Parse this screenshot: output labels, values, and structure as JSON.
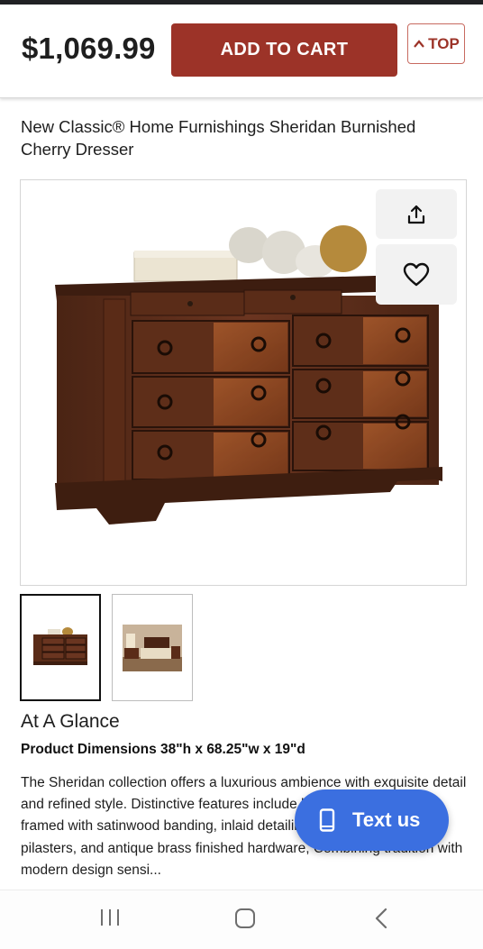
{
  "header": {
    "price": "$1,069.99",
    "add_to_cart_label": "ADD TO CART",
    "top_label": "TOP"
  },
  "product": {
    "title": "New Classic® Home Furnishings Sheridan Burnished Cherry Dresser",
    "main_image_icon": "dresser-image",
    "actions": {
      "share_icon": "share-icon",
      "favorite_icon": "heart-icon"
    },
    "thumbnails": [
      {
        "icon": "dresser-thumbnail",
        "selected": true
      },
      {
        "icon": "bedroom-thumbnail",
        "selected": false
      }
    ]
  },
  "details": {
    "heading": "At A Glance",
    "dimensions": "Product Dimensions 38\"h x 68.25\"w x 19\"d",
    "description": "The Sheridan collection offers a luxurious ambience with exquisite detail and refined style. Distinctive features include bookmatched veneers framed with satinwood banding, inlaid detailing on case tops, reeded pilasters, and antique brass finished hardware, Combining tradition with modern design sensi..."
  },
  "chat": {
    "label": "Text us",
    "icon": "phone-icon"
  },
  "system_nav": {
    "recents_icon": "recents-icon",
    "home_icon": "home-icon",
    "back_icon": "back-icon"
  },
  "colors": {
    "accent": "#9c3328",
    "chat": "#3b6fe0"
  }
}
